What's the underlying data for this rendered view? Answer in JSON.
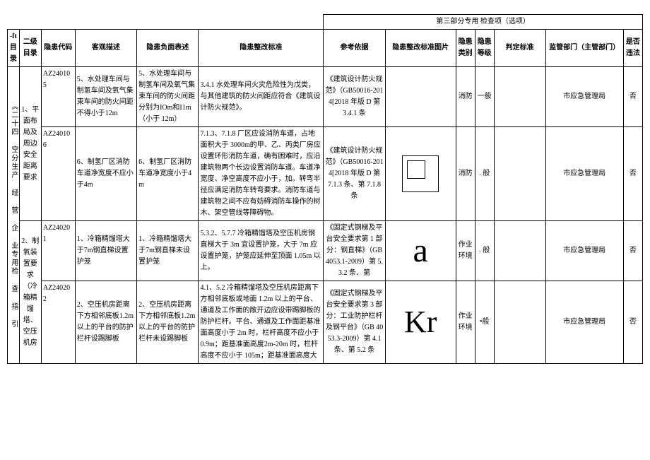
{
  "section_header": "第三部分专用 检查项（选项）",
  "headers": {
    "col0": "-ft 目录",
    "col1": "二级目录",
    "col2": "隐患代码",
    "col3": "客观描述",
    "col4": "隐患负面表述",
    "col5": "隐患整改标准",
    "col6": "参考依据",
    "col7": "隐患整改标准图片",
    "col8": "隐患类别",
    "col9": "隐患等级",
    "col10": "判定标准",
    "col11": "监管部门（主管部门）",
    "col12": "是否违法"
  },
  "side_title": "《二十四 空分生产 经 营 企 业专用检 查 指 引",
  "cat1": {
    "name": "1、平面布局及周边安全距离要求",
    "rows": {
      "r1": {
        "code": "AZ240105",
        "obj": "5、水处理车间与制氢车间及氧气集束车间的防火间距不得小于12m",
        "neg": "5、水处理车间与制氢车间及氧气集束车间的防火间距分别为IOm和I1m（小于 12m）",
        "std": "3.4.1 水处理车间火灾危险性为戊类，与其他建筑的防火间距应符合《建筑设计防火规范》。",
        "ref": "《建筑设计防火规范》（GB50016-2014[2018 年版 D 第 3.4.1 条",
        "cat": "消防",
        "level": "一般",
        "dept": "市应急管理局",
        "law": "否"
      },
      "r2": {
        "code": "AZ240106",
        "obj": "6、制氢厂区消防车道净宽度不应小于4m",
        "neg": "6、制氢厂区消防车道净宽度小于4m",
        "std": "7.1.3、7.1.8 厂区应设消防车道，占地面积大于 3000m的甲、乙、丙类厂房应设置环形消防车道，确有困难时，应沿建筑物两个长边设置消防车道。车道净宽度、净空高度不应小于，加。转弯半径应满足消防车转弯要求。消防车道与建筑物之间不应有妨碍消防车操作的树木、架空管线等障碍物。",
        "ref": "《建筑设计防火规范》（GB50016-2014[2018 年版 D 第 7.1.3 条、第 7.1.8 条",
        "cat": "消防",
        "level": ". 般",
        "dept": "市应急管理局",
        "law": "否"
      }
    }
  },
  "cat2": {
    "name": "2、制氧装置要求（冷箱精馏塔、空压机房",
    "rows": {
      "r3": {
        "code": "AZ240201",
        "obj": "1、冷箱精馏塔大于7m钢直梯设置护笼",
        "neg": "1、冷箱精馏塔大于7m钢直梯未设置护笼",
        "std": "5.3.2、5.7.7 冷箱精馏塔及空压机房钢直梯大于 3m 宜设置护笼，大于 7m 应设置护笼，护笼应延伸至顶面 1.05m 以上。",
        "ref": "《固定式钢梯及平台安全要求第 1 部分：钢直梯》（GB 4053.1-2009）第 5.3.2 条、第",
        "pic": "a",
        "cat": "作业环境",
        "level": ". 般",
        "dept": "市应急管理局",
        "law": "否"
      },
      "r4": {
        "code": "AZ240202",
        "obj": "2、空压机房距离下方相邻底板1.2m以上的平台的防护栏杆设踢脚板",
        "neg": "2、空压机房距离下方相邻底板1.2m以上的平台的防护栏杆未设踢脚板",
        "std": "4.1、5.2 冷箱精馏塔及空压机房距离下方相邻底板或地面 1.2m 以上的平台、通道及工作面的敞开边应设带踢脚板的防护栏杆。平台、通道及工作面距基准面高度小于 2m 时，栏杆高度不应小于 0.9m；距基准面高度2m-20m 时，栏杆高度不应小于 105m；距基准面高度大",
        "ref": "《固定式钢梯及平台安全要求第 3 部分：工业防护栏杆及钢平台》（GB 4053.3-2009）第 4.1 条、第 5.2 条",
        "pic": "Kr",
        "cat": "作业环境",
        "level": "•般",
        "dept": "市应急管理局",
        "law": "否"
      }
    }
  }
}
